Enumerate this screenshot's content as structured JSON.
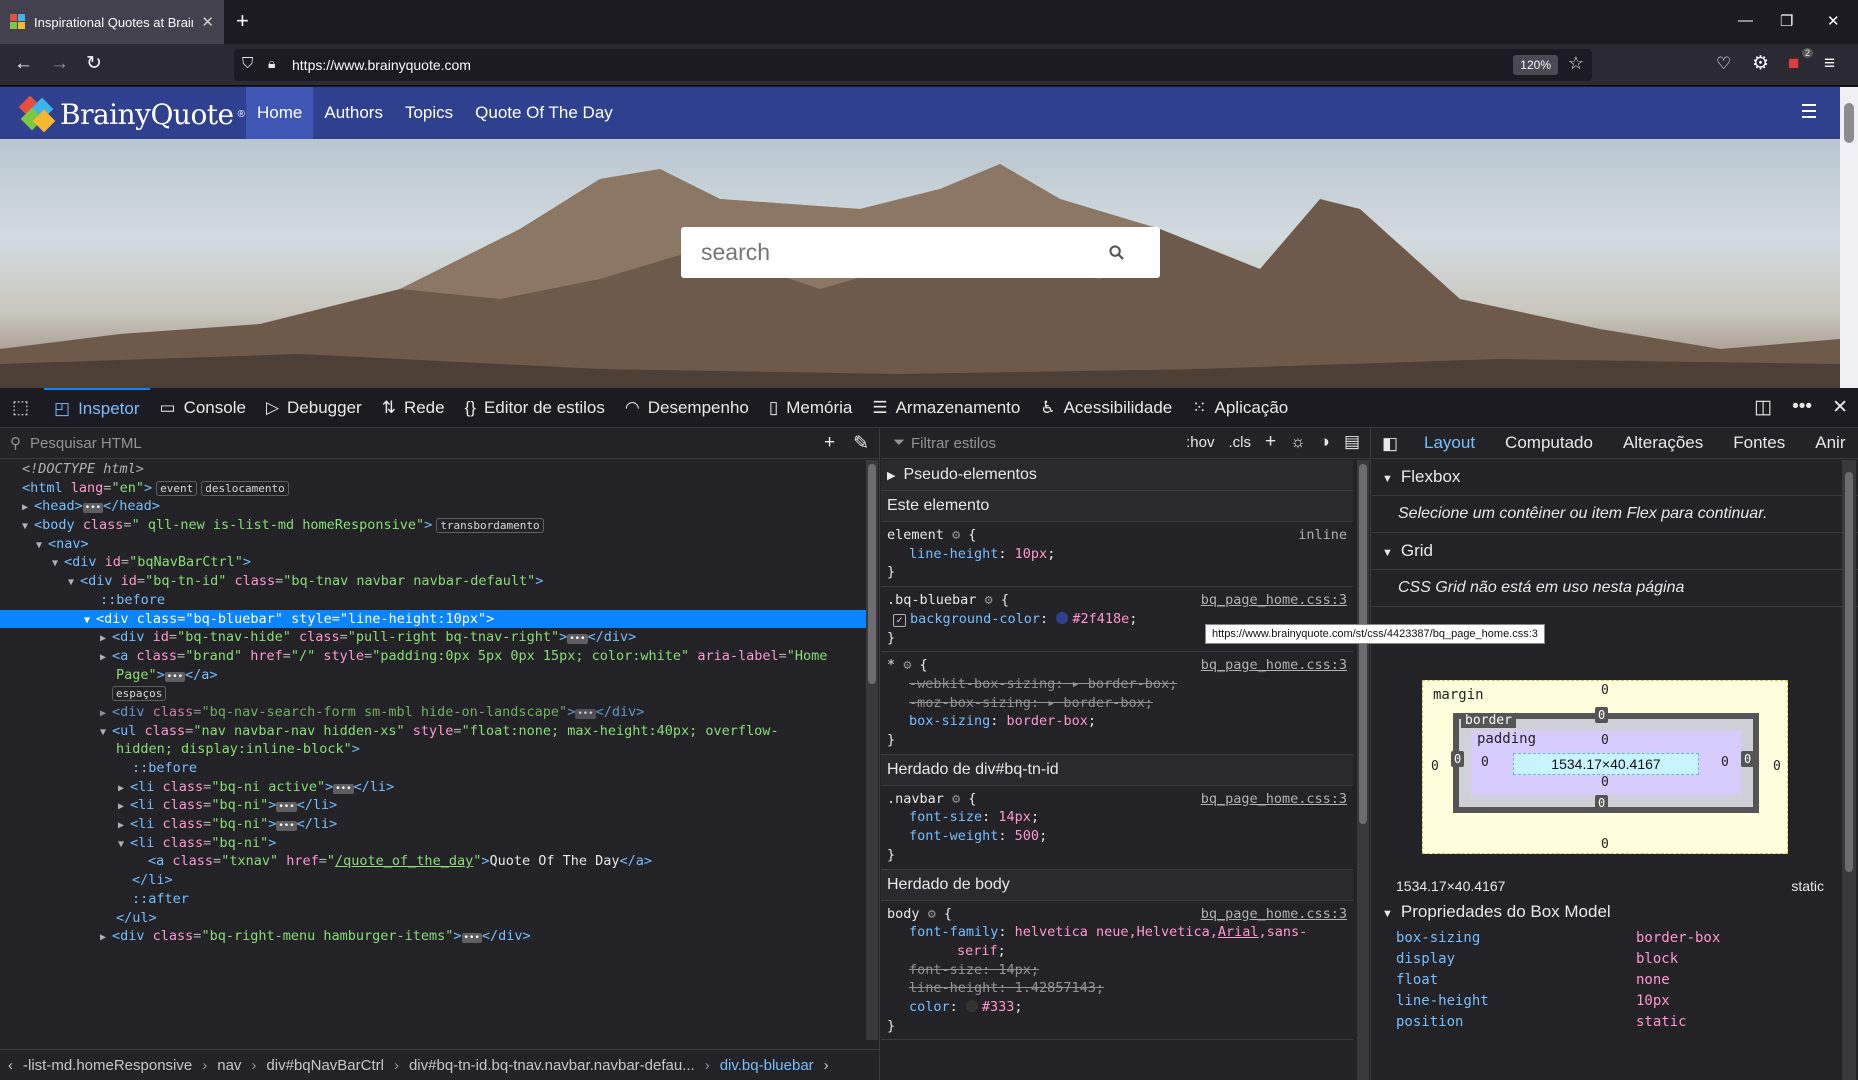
{
  "browser": {
    "tab_title": "Inspirational Quotes at BrainyQu",
    "new_tab_symbol": "+",
    "url": "https://www.brainyquote.com",
    "zoom": "120%",
    "ext_badge": "2"
  },
  "site": {
    "logo_text": "BrainyQuote",
    "logo_reg": "®",
    "menu": [
      "Home",
      "Authors",
      "Topics",
      "Quote Of The Day"
    ],
    "search_placeholder": "search",
    "brand_color": "#2f418e"
  },
  "devtools": {
    "tabs": [
      "Inspetor",
      "Console",
      "Debugger",
      "Rede",
      "Editor de estilos",
      "Desempenho",
      "Memória",
      "Armazenamento",
      "Acessibilidade",
      "Aplicação"
    ],
    "html_search_placeholder": "Pesquisar HTML",
    "styles_filter_placeholder": "Filtrar estilos",
    "hov": ":hov",
    "cls": ".cls",
    "breadcrumbs": [
      "-list-md.homeResponsive",
      "nav",
      "div#bqNavBarCtrl",
      "div#bq-tn-id.bq-tnav.navbar.navbar-defau...",
      "div.bq-bluebar"
    ],
    "badges": {
      "event": "event",
      "scroll": "deslocamento",
      "overflow": "transbordamento",
      "whitespace": "espaços"
    }
  },
  "rules": {
    "pseudo_section": "Pseudo-elementos",
    "this_element": "Este elemento",
    "inherited_tn": "Herdado de div#bq-tn-id",
    "inherited_body": "Herdado de body",
    "inline_label": "inline",
    "source_file": "bq_page_home.css:3",
    "tooltip": "https://www.brainyquote.com/st/css/4423387/bq_page_home.css:3"
  },
  "layout": {
    "tabs": [
      "Layout",
      "Computado",
      "Alterações",
      "Fontes",
      "Anir"
    ],
    "flexbox_title": "Flexbox",
    "flexbox_msg": "Selecione um contêiner ou item Flex para continuar.",
    "grid_title": "Grid",
    "grid_msg": "CSS Grid não está em uso nesta página",
    "box": {
      "margin_label": "margin",
      "border_label": "border",
      "padding_label": "padding",
      "content": "1534.17×40.4167",
      "zero": "0"
    },
    "dimensions": "1534.17×40.4167",
    "position": "static",
    "props_title": "Propriedades do Box Model",
    "props": [
      {
        "k": "box-sizing",
        "v": "border-box"
      },
      {
        "k": "display",
        "v": "block"
      },
      {
        "k": "float",
        "v": "none"
      },
      {
        "k": "line-height",
        "v": "10px"
      },
      {
        "k": "position",
        "v": "static"
      }
    ]
  }
}
